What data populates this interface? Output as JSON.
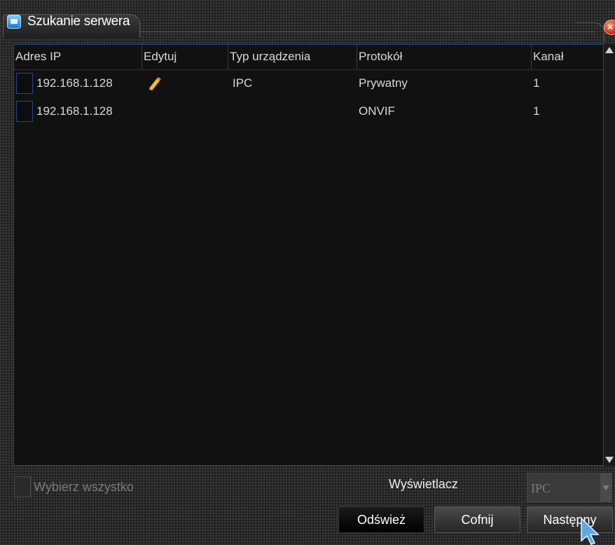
{
  "window": {
    "title": "Szukanie serwera"
  },
  "table": {
    "columns": [
      "Adres IP",
      "Edytuj",
      "Typ urządzenia",
      "Protokół",
      "Kanał"
    ],
    "rows": [
      {
        "ip": "192.168.1.128",
        "edit_icon": "pencil-icon",
        "device_type": "IPC",
        "protocol": "Prywatny",
        "channel": "1",
        "checked": false
      },
      {
        "ip": "192.168.1.128",
        "edit_icon": "",
        "device_type": "",
        "protocol": "ONVIF",
        "channel": "1",
        "checked": false
      }
    ]
  },
  "footer": {
    "select_all_label": "Wybierz wszystko",
    "display_label": "Wyświetlacz",
    "display_value": "IPC"
  },
  "buttons": {
    "refresh": "Odśwież",
    "back": "Cofnij",
    "next": "Następny"
  },
  "colors": {
    "table_background": "#111111",
    "table_border": "#1f4a8a",
    "window_background": "#2b2b2b",
    "text": "#d8d8d8",
    "disabled_text": "#7a7a7a",
    "close_button": "#d8301a"
  }
}
